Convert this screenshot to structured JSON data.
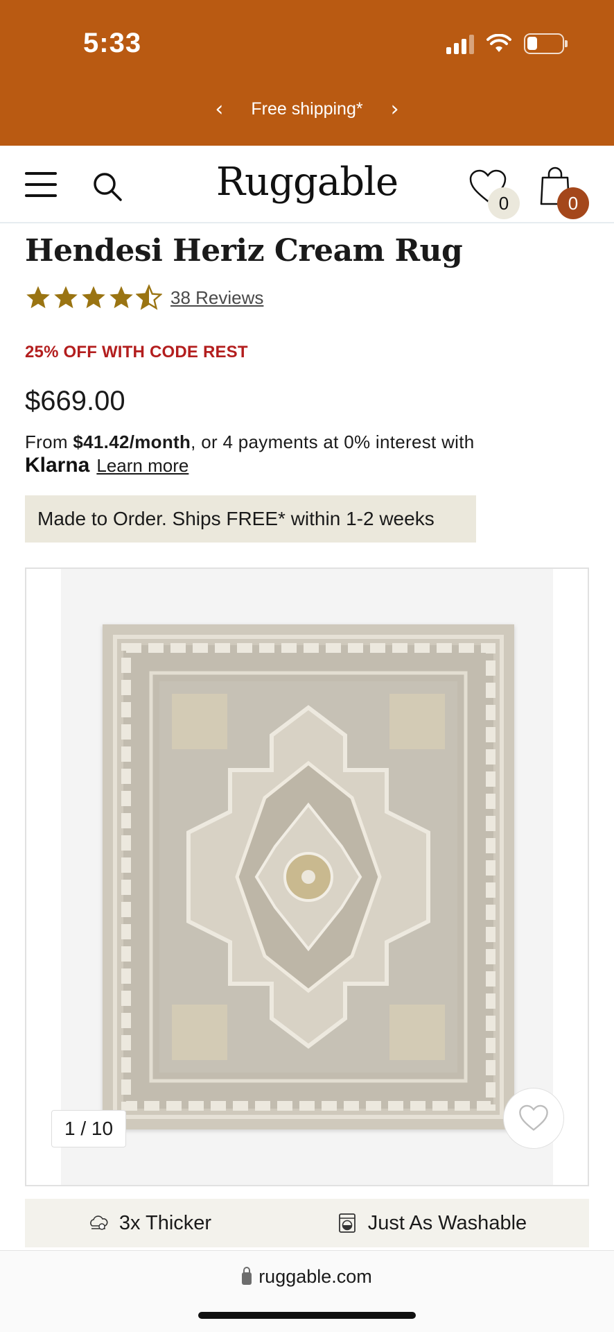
{
  "status_bar": {
    "time": "5:33"
  },
  "promo_banner": {
    "text": "Free shipping*",
    "prev_arrow": "‹",
    "next_arrow": "›"
  },
  "header": {
    "logo": "Ruggable",
    "wishlist_count": "0",
    "cart_count": "0",
    "icons": [
      "menu-icon",
      "search-icon",
      "heart-icon",
      "shopping-bag-icon"
    ]
  },
  "product": {
    "title": "Hendesi Heriz Cream Rug",
    "rating": 4.5,
    "reviews_label": "38 Reviews",
    "promo_code": "25% OFF WITH CODE REST",
    "price": "$669.00",
    "klarna": {
      "prefix": "From ",
      "monthly": "$41.42/month",
      "suffix": ", or 4 payments at 0% interest with",
      "brand": "Klarna",
      "learn_more": "Learn more"
    },
    "shipping_note": "Made to Order. Ships FREE* within 1-2 weeks"
  },
  "gallery": {
    "counter": "1 / 10",
    "current_index": 1,
    "total_images": 10
  },
  "features": [
    {
      "label": "3x Thicker",
      "icon": "cloud-layers-icon"
    },
    {
      "label": "Just As Washable",
      "icon": "washing-machine-icon"
    }
  ],
  "browser": {
    "url": "ruggable.com"
  },
  "colors": {
    "banner": "#b95a12",
    "promo_red": "#b31e1e",
    "star_gold": "#9a7412",
    "cart_badge": "#a4471b",
    "beige": "#ebe8dc"
  }
}
